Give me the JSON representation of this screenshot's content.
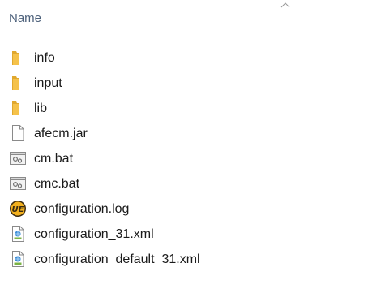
{
  "header": {
    "name_column": "Name",
    "sort_indicator": "chevron-up-icon"
  },
  "files": [
    {
      "name": "info",
      "icon": "folder-icon",
      "kind": "folder"
    },
    {
      "name": "input",
      "icon": "folder-icon",
      "kind": "folder"
    },
    {
      "name": "lib",
      "icon": "folder-icon",
      "kind": "folder"
    },
    {
      "name": "afecm.jar",
      "icon": "blank-file-icon",
      "kind": "file"
    },
    {
      "name": "cm.bat",
      "icon": "batch-file-icon",
      "kind": "batch"
    },
    {
      "name": "cmc.bat",
      "icon": "batch-file-icon",
      "kind": "batch"
    },
    {
      "name": "configuration.log",
      "icon": "ultraedit-icon",
      "kind": "log"
    },
    {
      "name": "configuration_31.xml",
      "icon": "xml-file-icon",
      "kind": "xml"
    },
    {
      "name": "configuration_default_31.xml",
      "icon": "xml-file-icon",
      "kind": "xml"
    }
  ],
  "colors": {
    "header_text": "#4c607a",
    "folder": "#f5c24a",
    "folder_dark": "#e0a82e",
    "text": "#1a1a1a"
  }
}
